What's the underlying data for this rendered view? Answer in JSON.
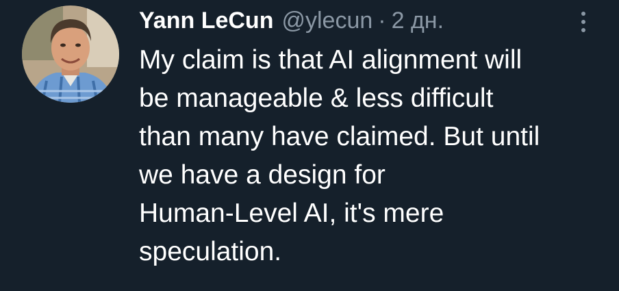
{
  "tweet": {
    "author": {
      "name": "Yann LeCun",
      "handle": "@ylecun",
      "avatar_icon": "profile-photo"
    },
    "separator": "·",
    "timestamp": "2 дн.",
    "more_icon": "more-vertical-icon",
    "text_lines": [
      "My claim is that AI alignment will",
      "be manageable & less difficult",
      "than many have claimed. But until",
      "we have a design for",
      "Human-Level AI, it's mere",
      "speculation."
    ]
  },
  "colors": {
    "background": "#15202b",
    "primary_text": "#ffffff",
    "secondary_text": "#8b98a5"
  }
}
